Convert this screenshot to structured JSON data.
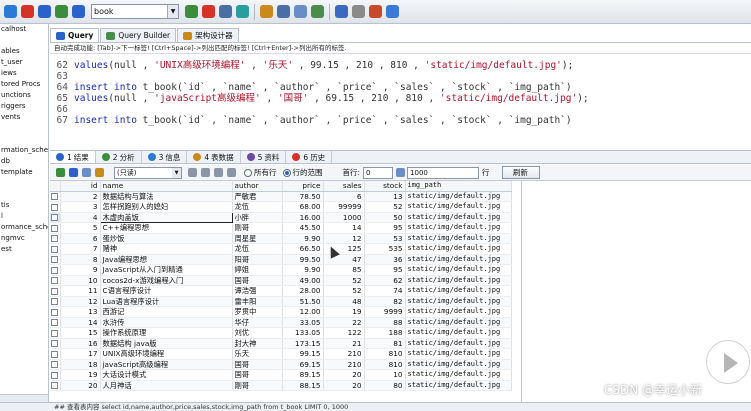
{
  "toolbar": {
    "database": "book",
    "icons": [
      {
        "name": "connect-icon",
        "color": "#2a7ad6"
      },
      {
        "name": "disconnect-icon",
        "color": "#d6322a"
      },
      {
        "name": "refresh-icon",
        "color": "#2a62c9"
      },
      {
        "name": "back-icon",
        "color": "#3a8d3a"
      },
      {
        "name": "forward-icon",
        "color": "#2a62c9"
      },
      {
        "name": "execute-icon",
        "color": "#3a8d3a"
      },
      {
        "name": "stop-icon",
        "color": "#d6322a"
      },
      {
        "name": "new-table-icon",
        "color": "#4a6fa5"
      },
      {
        "name": "schema-icon",
        "color": "#2a9e9e"
      },
      {
        "name": "backup-icon",
        "color": "#c88a1a"
      },
      {
        "name": "import-icon",
        "color": "#4a6fa5"
      },
      {
        "name": "export-icon",
        "color": "#6a8cc7"
      },
      {
        "name": "sync-icon",
        "color": "#4a8c4a"
      },
      {
        "name": "user-icon",
        "color": "#3a6ac0"
      },
      {
        "name": "settings-icon",
        "color": "#8a8a8a"
      },
      {
        "name": "tools-icon",
        "color": "#c84a2a"
      },
      {
        "name": "help-icon",
        "color": "#3a7ad6"
      }
    ]
  },
  "sidebar": {
    "items": [
      "calhost",
      "",
      "ables",
      "t_user",
      "iews",
      "tored Procs",
      "unctions",
      "riggers",
      "vents",
      "",
      "",
      "rmation_schem",
      "db",
      "template",
      "",
      "",
      "tis",
      "l",
      "ormance_schem",
      "ngmvc",
      "est"
    ]
  },
  "query_tabs": [
    {
      "label": "Query",
      "icon": "query-icon",
      "color": "#2a62c9"
    },
    {
      "label": "Query Builder",
      "icon": "query-builder-icon",
      "color": "#4a8c4a"
    },
    {
      "label": "架构设计器",
      "icon": "schema-designer-icon",
      "color": "#c88a1a"
    }
  ],
  "hint": "自动完成功能: [Tab]->下一标签! [Ctrl+Space]->列出匹配的标签! [Ctrl+Enter]->列出所有的标签.",
  "editor": [
    {
      "n": "62",
      "kw1": "values",
      "rest": "(null , ",
      "s1": "'UNIX高级环境编程'",
      "m1": " , ",
      "s2": "'乐天'",
      "m2": " , 99.15 , 210 , 810 , ",
      "s3": "'static/img/default.jpg'",
      "end": ");"
    },
    {
      "n": "63",
      "kw1": "",
      "rest": "",
      "s1": "",
      "m1": "",
      "s2": "",
      "m2": "",
      "s3": "",
      "end": ""
    },
    {
      "n": "64",
      "kw1": "insert into",
      "rest": " t_book(`id` , `name` , `author` , `price` , `sales` , `stock` , `img_path`)",
      "s1": "",
      "m1": "",
      "s2": "",
      "m2": "",
      "s3": "",
      "end": ""
    },
    {
      "n": "65",
      "kw1": "values",
      "rest": "(null , ",
      "s1": "'javaScript高级编程'",
      "m1": " , ",
      "s2": "'国哥'",
      "m2": " , 69.15 , 210 , 810 , ",
      "s3": "'static/img/default.jpg'",
      "end": ");"
    },
    {
      "n": "66",
      "kw1": "",
      "rest": "",
      "s1": "",
      "m1": "",
      "s2": "",
      "m2": "",
      "s3": "",
      "end": ""
    },
    {
      "n": "67",
      "kw1": "insert into",
      "rest": " t_book(`id` , `name` , `author` , `price` , `sales` , `stock` , `img_path`)",
      "s1": "",
      "m1": "",
      "s2": "",
      "m2": "",
      "s3": "",
      "end": ""
    }
  ],
  "result_tabs": [
    {
      "num": "1",
      "label": "结果",
      "color": "#2a62c9"
    },
    {
      "num": "2",
      "label": "分析",
      "color": "#3a8d3a"
    },
    {
      "num": "3",
      "label": "信息",
      "color": "#2a7ad6"
    },
    {
      "num": "4",
      "label": "表数据",
      "color": "#c88a1a"
    },
    {
      "num": "5",
      "label": "资料",
      "color": "#6a4aa5"
    },
    {
      "num": "6",
      "label": "历史",
      "color": "#d6322a"
    }
  ],
  "result_toolbar": {
    "mode": "(只读)",
    "radio_all": "所有行",
    "radio_range": "行的范围",
    "first_row_label": "首行:",
    "first_row": "0",
    "row_count": "1000",
    "rows_label": "行",
    "refresh": "刷新"
  },
  "grid": {
    "columns": [
      "id",
      "name",
      "author",
      "price",
      "sales",
      "stock",
      "img_path"
    ],
    "rows": [
      [
        "2",
        "数据结构与算法",
        "严敏君",
        "78.50",
        "6",
        "13",
        "static/img/default.jpg"
      ],
      [
        "3",
        "怎样拐跑别人的媳妇",
        "龙伍",
        "68.00",
        "99999",
        "52",
        "static/img/default.jpg"
      ],
      [
        "4",
        "木虚肉盖饭",
        "小胖",
        "16.00",
        "1000",
        "50",
        "static/img/default.jpg"
      ],
      [
        "5",
        "C++编程思想",
        "刚哥",
        "45.50",
        "14",
        "95",
        "static/img/default.jpg"
      ],
      [
        "6",
        "蛋炒饭",
        "周星星",
        "9.90",
        "12",
        "53",
        "static/img/default.jpg"
      ],
      [
        "7",
        "赌神",
        "龙伍",
        "66.50",
        "125",
        "535",
        "static/img/default.jpg"
      ],
      [
        "8",
        "Java编程思想",
        "阳哥",
        "99.50",
        "47",
        "36",
        "static/img/default.jpg"
      ],
      [
        "9",
        "JavaScript从入门到精通",
        "婷姐",
        "9.90",
        "85",
        "95",
        "static/img/default.jpg"
      ],
      [
        "10",
        "cocos2d-x游戏编程入门",
        "国哥",
        "49.00",
        "52",
        "62",
        "static/img/default.jpg"
      ],
      [
        "11",
        "C语言程序设计",
        "谭浩强",
        "28.00",
        "52",
        "74",
        "static/img/default.jpg"
      ],
      [
        "12",
        "Lua语言程序设计",
        "雷丰阳",
        "51.50",
        "48",
        "82",
        "static/img/default.jpg"
      ],
      [
        "13",
        "西游记",
        "罗贯中",
        "12.00",
        "19",
        "9999",
        "static/img/default.jpg"
      ],
      [
        "14",
        "水浒传",
        "华仔",
        "33.05",
        "22",
        "88",
        "static/img/default.jpg"
      ],
      [
        "15",
        "操作系统原理",
        "刘优",
        "133.05",
        "122",
        "188",
        "static/img/default.jpg"
      ],
      [
        "16",
        "数据结构 java版",
        "封大神",
        "173.15",
        "21",
        "81",
        "static/img/default.jpg"
      ],
      [
        "17",
        "UNIX高级环境编程",
        "乐天",
        "99.15",
        "210",
        "810",
        "static/img/default.jpg"
      ],
      [
        "18",
        "javaScript高级编程",
        "国哥",
        "69.15",
        "210",
        "810",
        "static/img/default.jpg"
      ],
      [
        "19",
        "大话设计模式",
        "国哥",
        "89.15",
        "20",
        "10",
        "static/img/default.jpg"
      ],
      [
        "20",
        "人月神话",
        "刚哥",
        "88.15",
        "20",
        "80",
        "static/img/default.jpg"
      ]
    ]
  },
  "status": "## 查看表内容 select id,name,author,price,sales,stock,img_path from t_book LIMIT 0, 1000",
  "watermark": "CSDN @幸运小新"
}
